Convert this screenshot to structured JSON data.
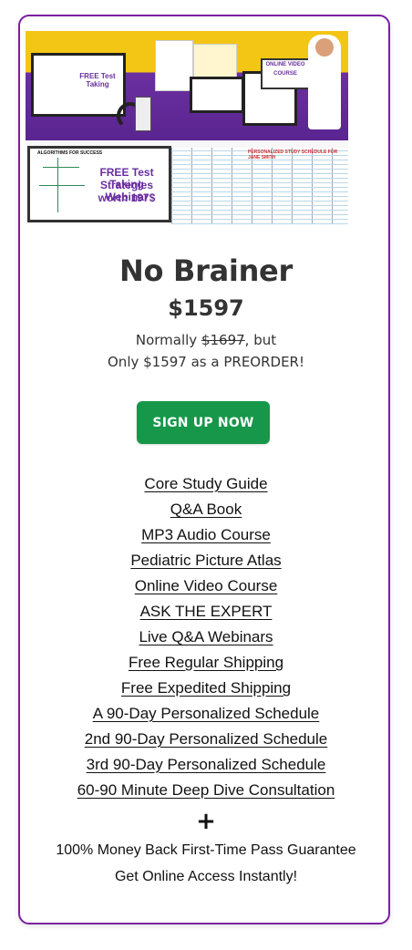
{
  "hero": {
    "image_name": "product-bundle-collage",
    "webinar_line1": "FREE Test Taking",
    "webinar_line2": "Strategies Webinar",
    "webinar_line3": "worth 197$",
    "online_course_label": "ONLINE VIDEO COURSE",
    "algorithm_label": "ALGORITHMS FOR SUCCESS",
    "schedule_label": "PERSONALIZED STUDY SCHEDULE FOR JANE SMITH",
    "colors": {
      "yellow": "#f3c514",
      "purple": "#6b2fa0"
    }
  },
  "product": {
    "title": "No Brainer",
    "price": "$1597",
    "normally_prefix": "Normally ",
    "normally_strike": "$1697",
    "normally_suffix": ", but",
    "preorder": "Only $1597 as a PREORDER!"
  },
  "cta": {
    "label": "SIGN UP NOW",
    "color": "#17974a"
  },
  "features": [
    "Core Study Guide",
    "Q&A Book",
    "MP3 Audio Course ",
    "Pediatric Picture Atlas",
    "Online Video Course",
    "ASK THE EXPERT",
    "Live Q&A Webinars",
    "Free Regular Shipping",
    "Free Expedited Shipping",
    "A 90-Day Personalized Schedule",
    "2nd 90-Day Personalized Schedule",
    "3rd 90-Day Personalized Schedule",
    "60-90 Minute Deep Dive Consultation"
  ],
  "footer": {
    "plus": "+",
    "guarantee": "100% Money Back First-Time Pass Guarantee",
    "access": "Get Online Access Instantly!"
  },
  "theme": {
    "card_border": "#7b1fa2"
  }
}
